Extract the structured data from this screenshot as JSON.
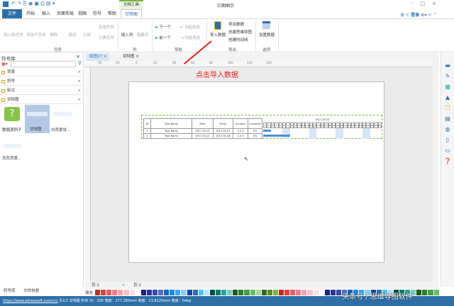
{
  "window": {
    "title": "亿图图示",
    "context_tab": "文档工具",
    "login": "登录"
  },
  "menu_tabs": [
    "文件",
    "开始",
    "插入",
    "页面布局",
    "视图",
    "符号",
    "帮助",
    "甘特图"
  ],
  "ribbon": {
    "task": {
      "buttons": [
        "插入新任务",
        "添加子任务",
        "删除",
        "缩进",
        "凸排",
        "连接任务",
        "分离任务"
      ],
      "group": "任务"
    },
    "column": {
      "buttons": [
        "插入列",
        "隐藏列"
      ],
      "group": "列"
    },
    "nav": {
      "buttons": [
        "下一个",
        "前一个",
        "到起始处",
        "到结束处"
      ],
      "group": "导航"
    },
    "export": {
      "buttons": [
        "导入数据",
        "导出数据",
        "创建思维导图",
        "创建时间线"
      ],
      "group": "导出"
    },
    "options": {
      "buttons": [
        "设置数据"
      ],
      "group": "选项"
    }
  },
  "annotation": "点击导入数据",
  "library": {
    "title": "符号库",
    "search_placeholder": "",
    "categories": [
      "背景",
      "符号",
      "标注",
      "甘特图"
    ],
    "shapes": [
      "数据源例子",
      "甘特图",
      "白背景甘...",
      "灰色背景..."
    ]
  },
  "doc_tabs": [
    "绘图17",
    "甘特图"
  ],
  "ruler": [
    "-40",
    "-20",
    "0",
    "20",
    "40",
    "60",
    "80",
    "100",
    "120",
    "140"
  ],
  "gantt": {
    "headers": [
      "ID",
      "Task Name",
      "Start",
      "Finish",
      "Duration",
      "Complete"
    ],
    "month": "2017-05-01",
    "days": [
      "1",
      "2",
      "3",
      "4",
      "5",
      "6",
      "7",
      "8",
      "9",
      "10",
      "11",
      "12",
      "13",
      "14",
      "15",
      "16",
      "17",
      "18",
      "19",
      "20",
      "21",
      "22",
      "23",
      "24",
      "25",
      "26",
      "27",
      "28",
      "29",
      "30",
      "31"
    ],
    "rows": [
      [
        "1",
        "Task Name",
        "2017-05-01",
        "2017-05-02",
        "2.0 d",
        "0%"
      ],
      [
        "2",
        "Task Name",
        "2017-05-01",
        "2017-05-08",
        "2.0 d",
        "0%"
      ]
    ],
    "bars": [
      {
        "start": 1,
        "end": 2
      },
      {
        "start": 1,
        "end": 7
      }
    ],
    "weekends": [
      6,
      7,
      13,
      14,
      20,
      21,
      27,
      28
    ]
  },
  "bottom": {
    "panel_tabs": [
      "符号库",
      "文件恢复"
    ],
    "page_tab": "页-1",
    "page_tab2": "页-1",
    "fill_label": "填充"
  },
  "status": {
    "url": "https://www.edrawsoft.com/cn/",
    "page": "页1/1",
    "shape_name": "甘特图",
    "shape_id": "形状 ID：106",
    "width": "宽度：277.283mm",
    "height": "高度：23.8125mm",
    "angle": "角度：0deg"
  },
  "watermark": "头条号 / 思维导图软件"
}
